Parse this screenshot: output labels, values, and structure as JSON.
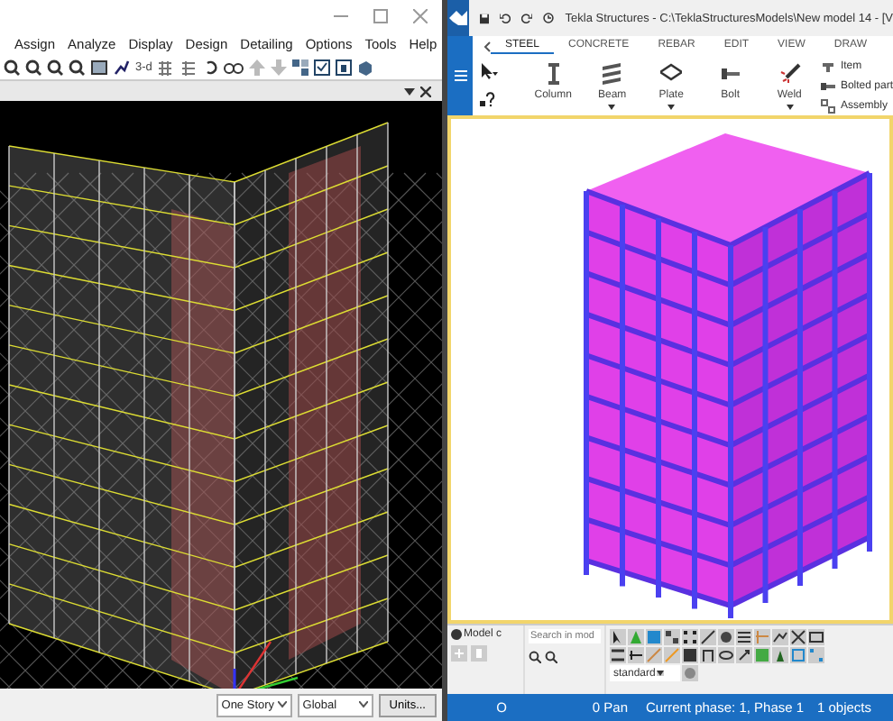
{
  "left_window": {
    "menu": [
      "Assign",
      "Analyze",
      "Display",
      "Design",
      "Detailing",
      "Options",
      "Tools",
      "Help"
    ],
    "toolbar_text": "3-d",
    "status_bar": {
      "story": "One Story",
      "coordinates": "Global",
      "units_button": "Units..."
    }
  },
  "right_window": {
    "title": "Tekla Structures - C:\\TeklaStructuresModels\\New model 14 - [V",
    "tabs": [
      {
        "label": "STEEL",
        "selected": true
      },
      {
        "label": "CONCRETE",
        "selected": false
      },
      {
        "label": "REBAR",
        "selected": false
      },
      {
        "label": "EDIT",
        "selected": false
      },
      {
        "label": "VIEW",
        "selected": false
      },
      {
        "label": "DRAW",
        "selected": false
      }
    ],
    "ribbon": [
      {
        "kind": "column",
        "label": "Column",
        "dropdown": false
      },
      {
        "kind": "beam",
        "label": "Beam",
        "dropdown": true
      },
      {
        "kind": "plate",
        "label": "Plate",
        "dropdown": true
      },
      {
        "kind": "bolt",
        "label": "Bolt",
        "dropdown": false
      },
      {
        "kind": "weld",
        "label": "Weld",
        "dropdown": true
      }
    ],
    "side_items": [
      "Item",
      "Bolted part",
      "Assembly"
    ],
    "panel_tab": "Model c",
    "search": {
      "placeholder": "Search in mod"
    },
    "style_select": "standard",
    "status_bar": [
      "O",
      "0 Pan",
      "Current phase: 1, Phase 1",
      "1 objects"
    ]
  }
}
